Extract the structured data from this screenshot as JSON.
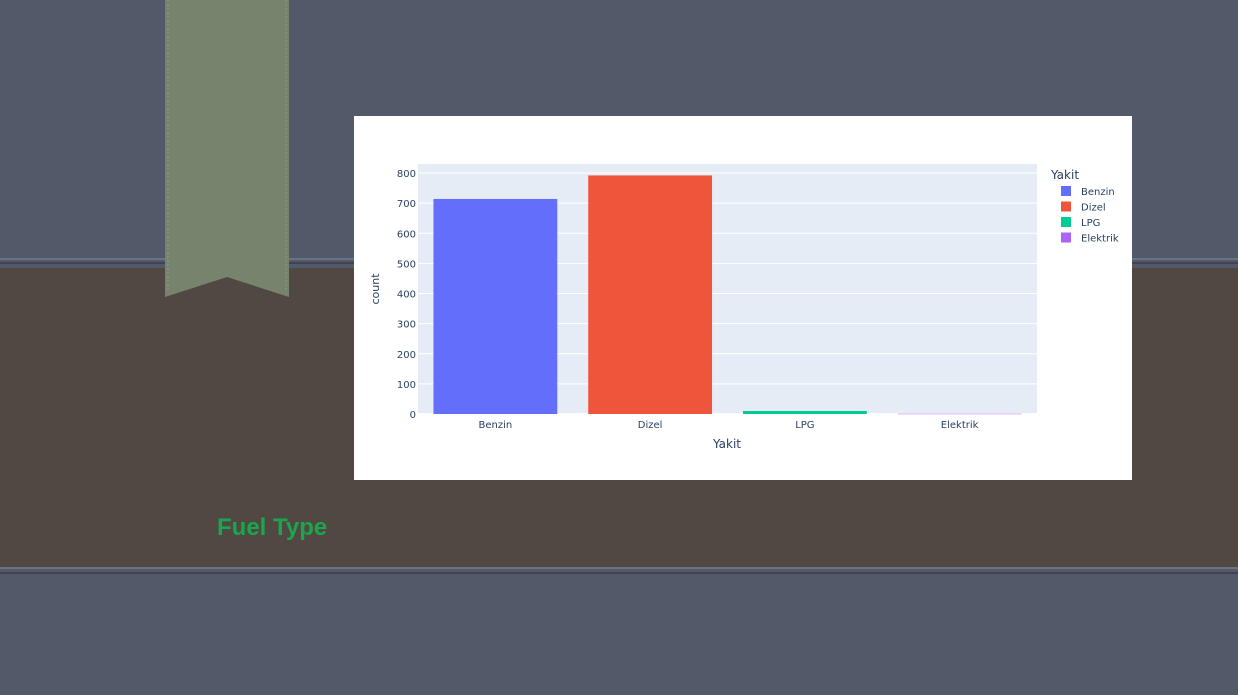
{
  "slide": {
    "title": "Fuel Type",
    "title_color": "#1aa64a",
    "background_color": "#525a6a",
    "band_color": "#514843",
    "ribbon_color": "#77846d"
  },
  "chart_data": {
    "type": "bar",
    "categories": [
      "Benzin",
      "Dizel",
      "LPG",
      "Elektrik"
    ],
    "values": [
      714,
      792,
      10,
      1
    ],
    "colors": [
      "#636efa",
      "#ef553b",
      "#00cc96",
      "#ab63fa"
    ],
    "xlabel": "Yakit",
    "ylabel": "count",
    "ylim": [
      0,
      830
    ],
    "yticks": [
      0,
      100,
      200,
      300,
      400,
      500,
      600,
      700,
      800
    ],
    "grid": true,
    "legend": {
      "title": "Yakit",
      "placement": "right",
      "entries": [
        "Benzin",
        "Dizel",
        "LPG",
        "Elektrik"
      ]
    }
  }
}
